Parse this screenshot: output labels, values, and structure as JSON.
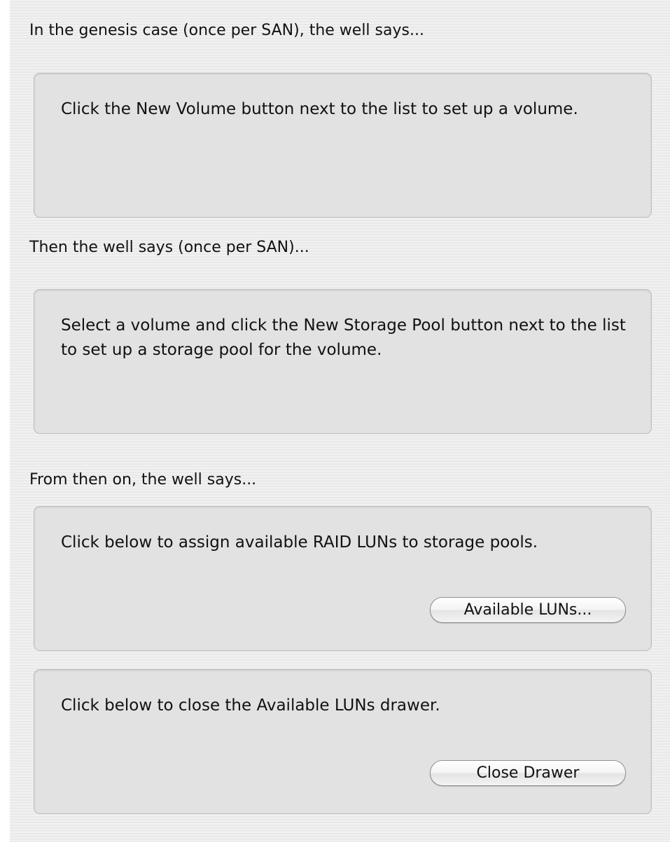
{
  "sections": [
    {
      "caption": "In the genesis case (once per SAN), the well says...",
      "wells": [
        {
          "text": "Click the New Volume button next to the list to set up a volume."
        }
      ]
    },
    {
      "caption": "Then the well says (once per SAN)...",
      "wells": [
        {
          "text": "Select a volume and click the New Storage Pool button next to the list to set up a storage pool for the volume."
        }
      ]
    },
    {
      "caption": "From then on, the well says...",
      "wells": [
        {
          "text": "Click below to assign available RAID LUNs to storage pools.",
          "button": "Available LUNs..."
        },
        {
          "text": "Click below to close the Available LUNs drawer.",
          "button": "Close Drawer"
        }
      ]
    }
  ]
}
